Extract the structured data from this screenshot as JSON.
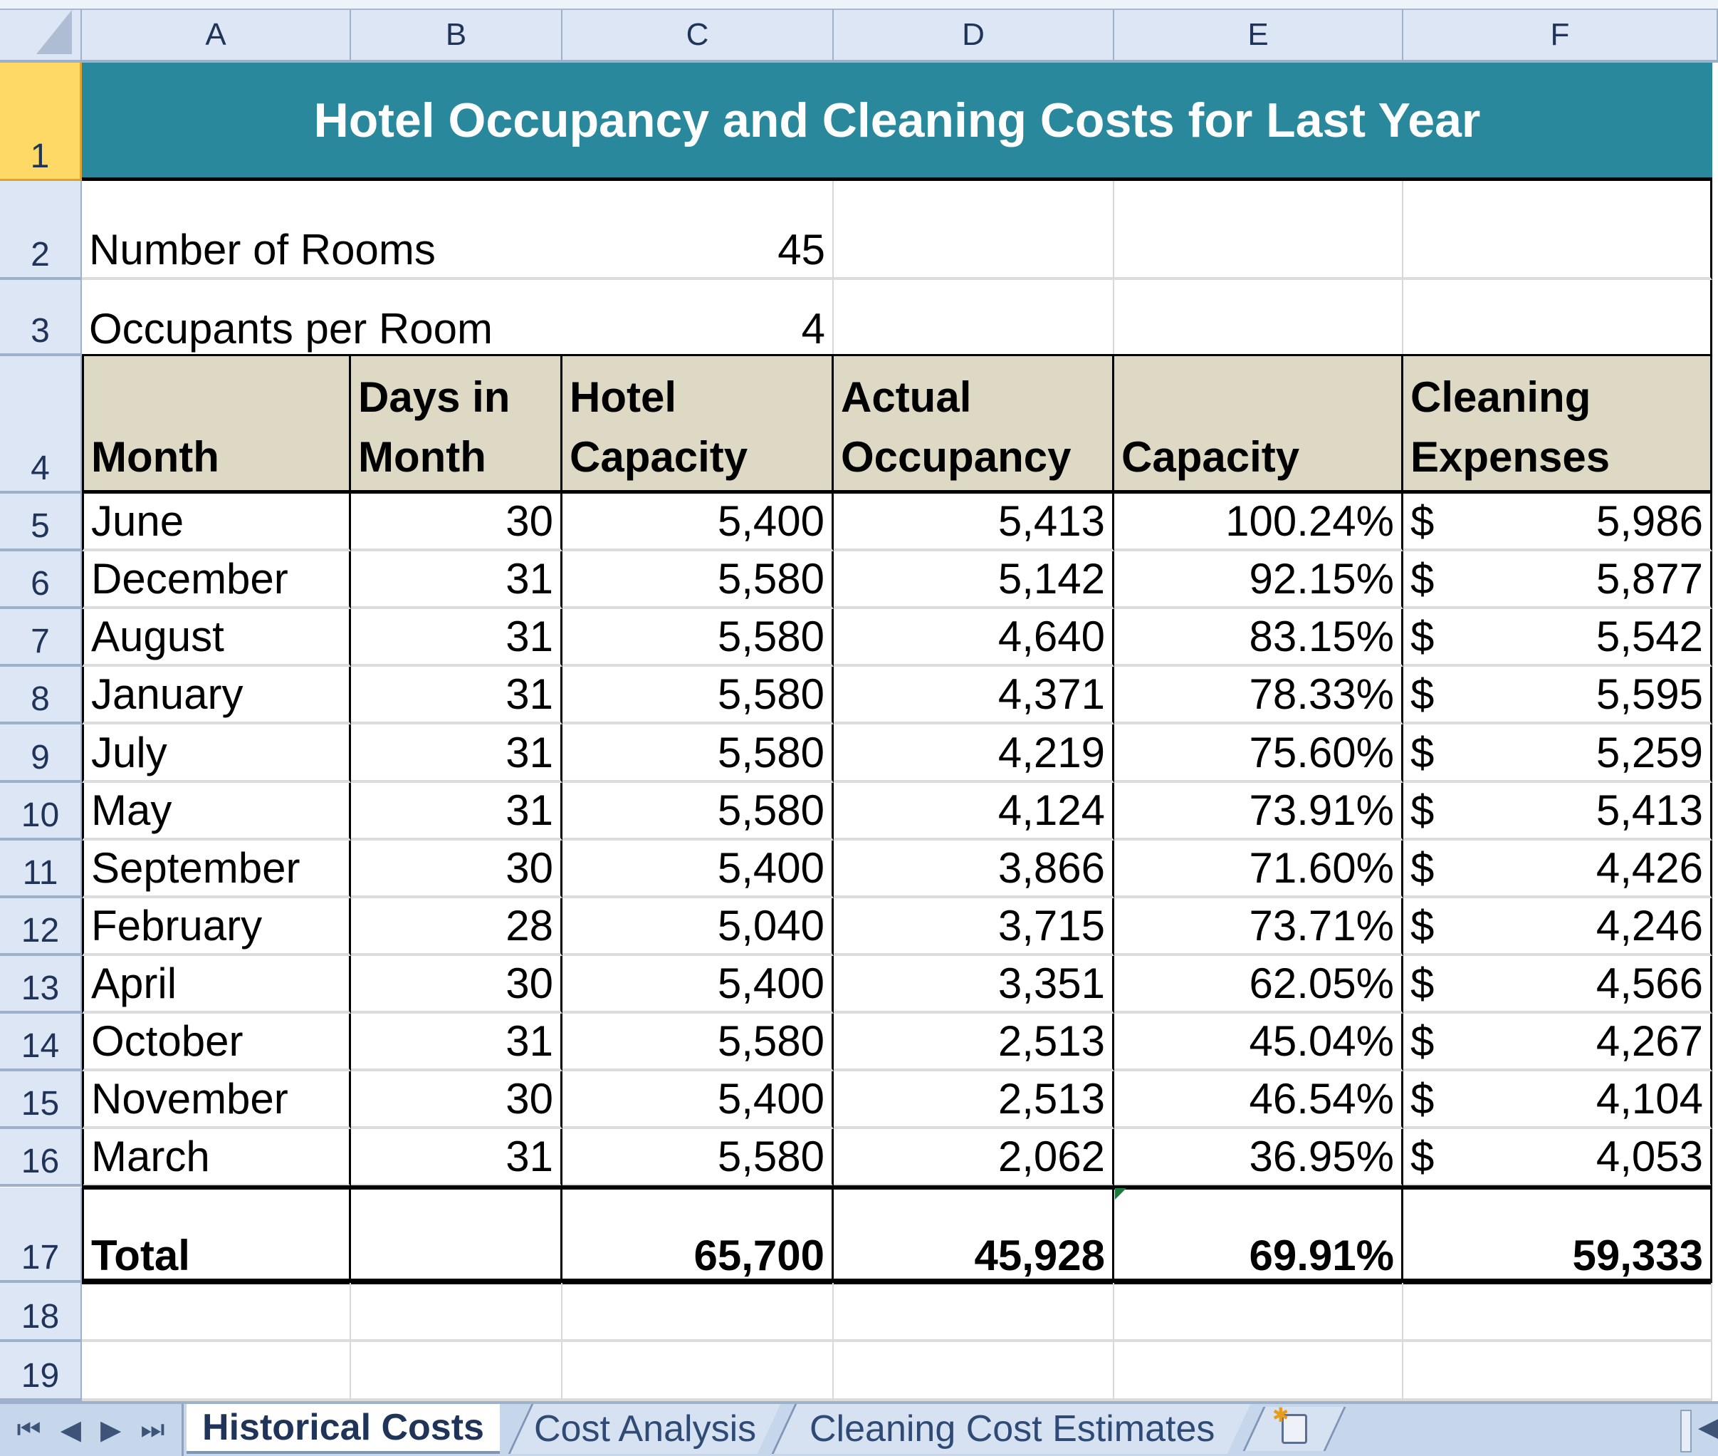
{
  "columns": [
    "A",
    "B",
    "C",
    "D",
    "E",
    "F"
  ],
  "rows": [
    "1",
    "2",
    "3",
    "4",
    "5",
    "6",
    "7",
    "8",
    "9",
    "10",
    "11",
    "12",
    "13",
    "14",
    "15",
    "16",
    "17",
    "18",
    "19"
  ],
  "title": "Hotel Occupancy and Cleaning Costs for Last Year",
  "inputs": {
    "rooms_label": "Number of Rooms",
    "rooms_value": "45",
    "occupants_label": "Occupants per Room",
    "occupants_value": "4"
  },
  "headers": {
    "month": [
      "",
      "Month"
    ],
    "days": [
      "Days in",
      "Month"
    ],
    "hotel_capacity": [
      "Hotel",
      "Capacity"
    ],
    "actual_occupancy": [
      "Actual",
      "Occupancy"
    ],
    "capacity": [
      "",
      "Capacity"
    ],
    "cleaning": [
      "Cleaning",
      "Expenses"
    ]
  },
  "table": [
    {
      "month": "June",
      "days": "30",
      "hotel_capacity": "5,400",
      "actual": "5,413",
      "pct": "100.24%",
      "currency": "$",
      "cleaning": "5,986"
    },
    {
      "month": "December",
      "days": "31",
      "hotel_capacity": "5,580",
      "actual": "5,142",
      "pct": "92.15%",
      "currency": "$",
      "cleaning": "5,877"
    },
    {
      "month": "August",
      "days": "31",
      "hotel_capacity": "5,580",
      "actual": "4,640",
      "pct": "83.15%",
      "currency": "$",
      "cleaning": "5,542"
    },
    {
      "month": "January",
      "days": "31",
      "hotel_capacity": "5,580",
      "actual": "4,371",
      "pct": "78.33%",
      "currency": "$",
      "cleaning": "5,595"
    },
    {
      "month": "July",
      "days": "31",
      "hotel_capacity": "5,580",
      "actual": "4,219",
      "pct": "75.60%",
      "currency": "$",
      "cleaning": "5,259"
    },
    {
      "month": "May",
      "days": "31",
      "hotel_capacity": "5,580",
      "actual": "4,124",
      "pct": "73.91%",
      "currency": "$",
      "cleaning": "5,413"
    },
    {
      "month": "September",
      "days": "30",
      "hotel_capacity": "5,400",
      "actual": "3,866",
      "pct": "71.60%",
      "currency": "$",
      "cleaning": "4,426"
    },
    {
      "month": "February",
      "days": "28",
      "hotel_capacity": "5,040",
      "actual": "3,715",
      "pct": "73.71%",
      "currency": "$",
      "cleaning": "4,246"
    },
    {
      "month": "April",
      "days": "30",
      "hotel_capacity": "5,400",
      "actual": "3,351",
      "pct": "62.05%",
      "currency": "$",
      "cleaning": "4,566"
    },
    {
      "month": "October",
      "days": "31",
      "hotel_capacity": "5,580",
      "actual": "2,513",
      "pct": "45.04%",
      "currency": "$",
      "cleaning": "4,267"
    },
    {
      "month": "November",
      "days": "30",
      "hotel_capacity": "5,400",
      "actual": "2,513",
      "pct": "46.54%",
      "currency": "$",
      "cleaning": "4,104"
    },
    {
      "month": "March",
      "days": "31",
      "hotel_capacity": "5,580",
      "actual": "2,062",
      "pct": "36.95%",
      "currency": "$",
      "cleaning": "4,053"
    }
  ],
  "totals": {
    "label": "Total",
    "days": "",
    "hotel_capacity": "65,700",
    "actual": "45,928",
    "pct": "69.91%",
    "cleaning": "59,333"
  },
  "sheet_tabs": [
    {
      "label": "Historical Costs",
      "active": true
    },
    {
      "label": "Cost Analysis",
      "active": false
    },
    {
      "label": "Cleaning Cost Estimates",
      "active": false
    }
  ],
  "nav_buttons": [
    "⏮",
    "◀",
    "▶",
    "⏭"
  ],
  "icons": {
    "select_all": "select-all-corner",
    "new_sheet": "insert-worksheet-icon",
    "error_indicator": "green-triangle-indicator"
  },
  "colors": {
    "title_bg": "#2a889d",
    "header_bg": "#ddd9c4",
    "selected_row_header": "#ffd966",
    "grid_header_bg": "#dce6f4"
  }
}
